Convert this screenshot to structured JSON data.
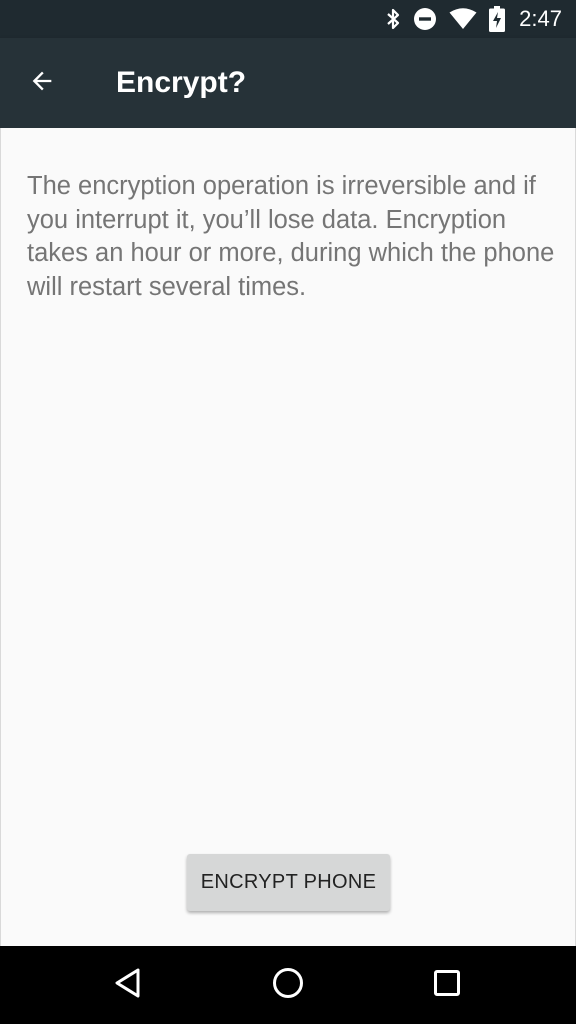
{
  "status_bar": {
    "time": "2:47",
    "icons": [
      "bluetooth-icon",
      "do-not-disturb-icon",
      "wifi-icon",
      "battery-charging-icon"
    ]
  },
  "app_bar": {
    "title": "Encrypt?",
    "back_icon": "arrow-back-icon"
  },
  "content": {
    "description": "The encryption operation is irreversible and if you interrupt it, you’ll lose data. Encryption takes an hour or more, during which the phone will restart several times.",
    "encrypt_button_label": "ENCRYPT PHONE"
  },
  "nav_bar": {
    "buttons": [
      "back-triangle-icon",
      "home-circle-icon",
      "recents-square-icon"
    ]
  },
  "colors": {
    "status_bar": "#1f2a30",
    "app_bar": "#263238",
    "background": "#fafafa",
    "text": "#757575",
    "button": "#d6d7d7"
  }
}
